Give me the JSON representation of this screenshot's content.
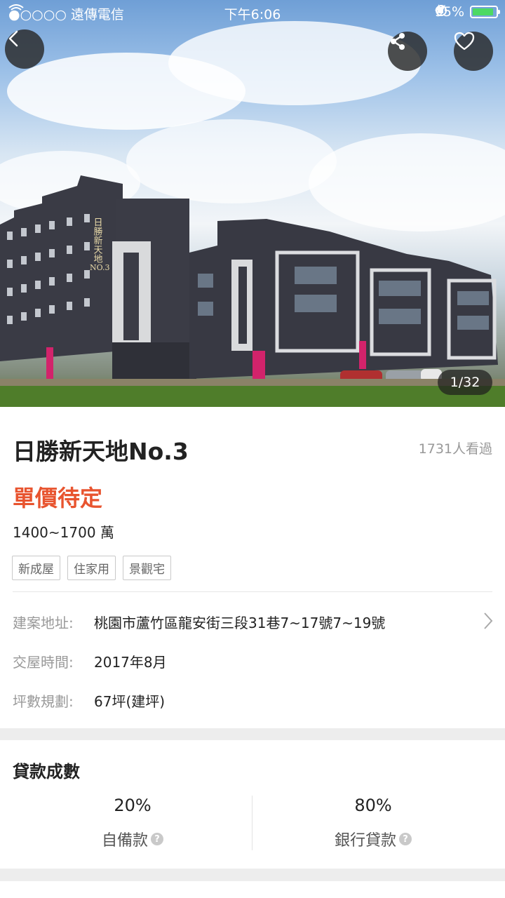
{
  "status_bar": {
    "carrier": "●○○○○ 遠傳電信",
    "time": "下午6:06",
    "battery": "95%"
  },
  "photo": {
    "counter": "1/32",
    "sign_text": "日勝新天地 NO.3"
  },
  "project": {
    "title": "日勝新天地No.3",
    "views": "1731人看過",
    "unit_price": "單價待定",
    "total_price": "1400~1700 萬",
    "tags": [
      "新成屋",
      "住家用",
      "景觀宅"
    ]
  },
  "details": {
    "address_label": "建案地址:",
    "address_value": "桃園市蘆竹區龍安街三段31巷7~17號7~19號",
    "date_label": "交屋時間:",
    "date_value": "2017年8月",
    "area_label": "坪數規劃:",
    "area_value": "67坪(建坪)"
  },
  "loan": {
    "title": "貸款成數",
    "down_pct": "20%",
    "down_label": "自備款",
    "bank_pct": "80%",
    "bank_label": "銀行貸款"
  },
  "icons": {
    "back": "chevron-left-icon",
    "share": "share-icon",
    "favorite": "heart-icon",
    "chevron": "chevron-right-icon",
    "help": "question-icon"
  },
  "colors": {
    "accent": "#e8542f",
    "battery": "#4cd964",
    "muted": "#999999"
  }
}
